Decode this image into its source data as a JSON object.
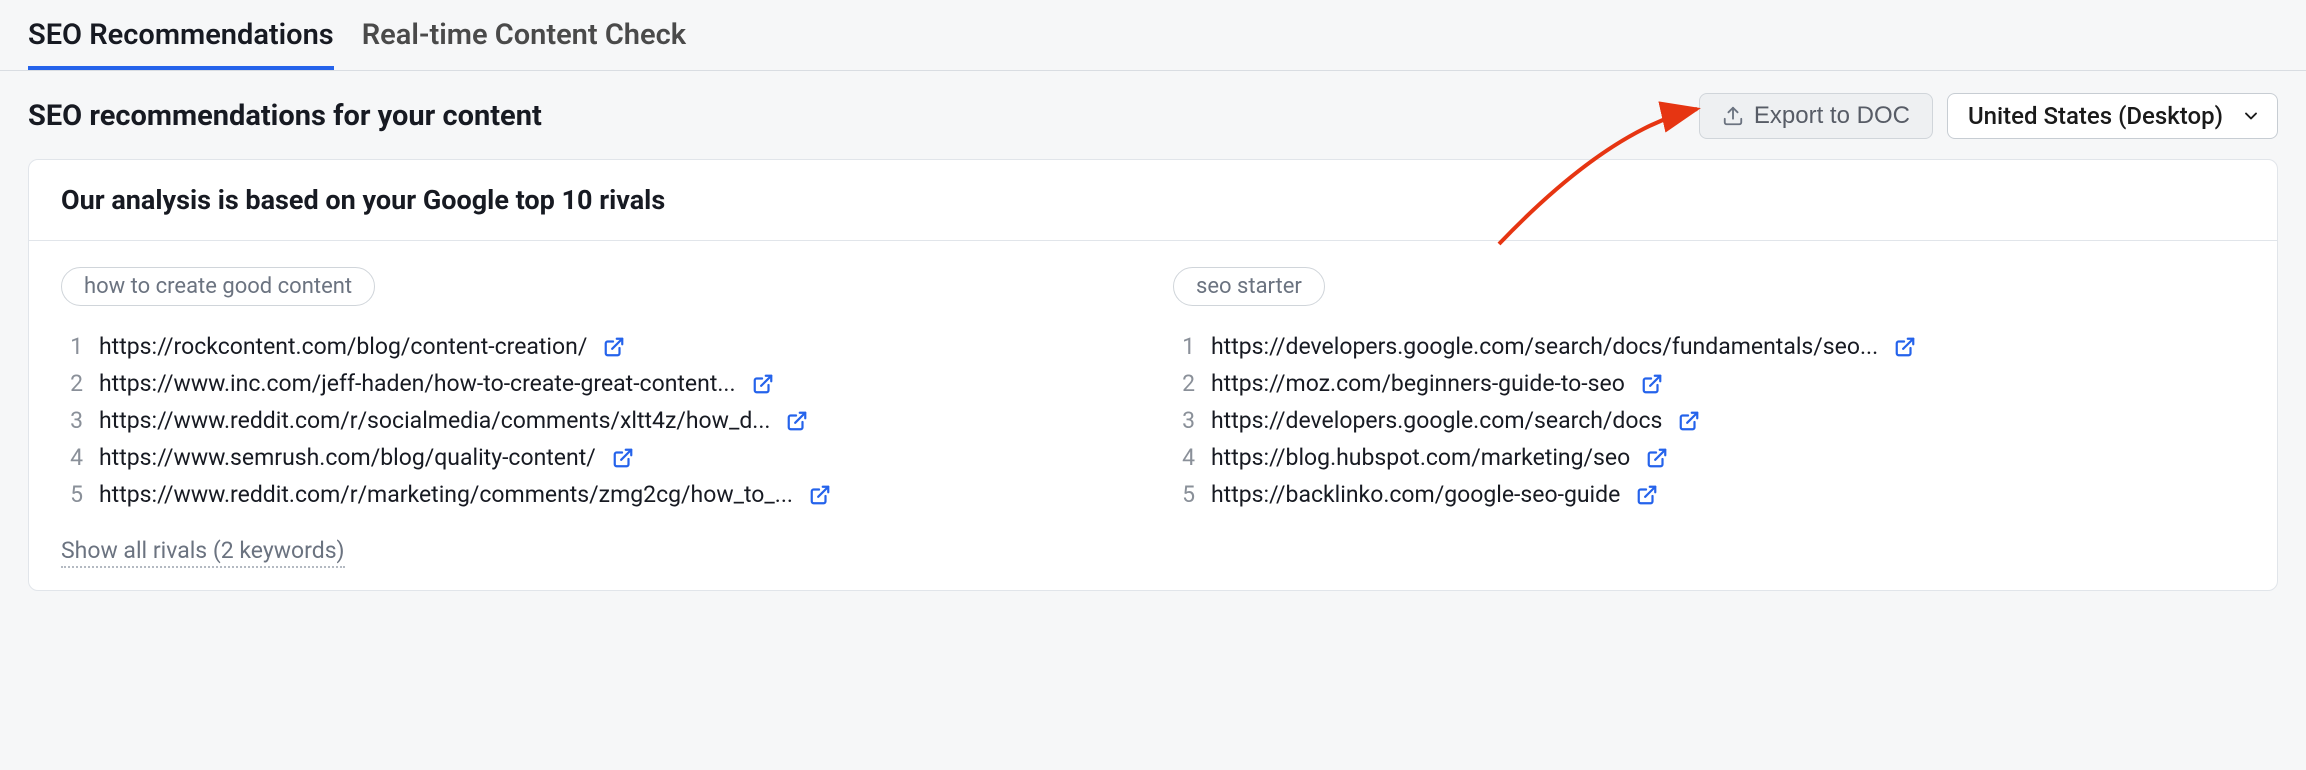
{
  "tabs": [
    {
      "label": "SEO Recommendations",
      "active": true
    },
    {
      "label": "Real-time Content Check",
      "active": false
    }
  ],
  "page_title": "SEO recommendations for your content",
  "export_label": "Export to DOC",
  "locale_selector": "United States (Desktop)",
  "card_title": "Our analysis is based on your Google top 10 rivals",
  "columns": [
    {
      "keyword": "how to create good content",
      "rivals": [
        "https://rockcontent.com/blog/content-creation/",
        "https://www.inc.com/jeff-haden/how-to-create-great-content...",
        "https://www.reddit.com/r/socialmedia/comments/xltt4z/how_d...",
        "https://www.semrush.com/blog/quality-content/",
        "https://www.reddit.com/r/marketing/comments/zmg2cg/how_to_..."
      ]
    },
    {
      "keyword": "seo starter",
      "rivals": [
        "https://developers.google.com/search/docs/fundamentals/seo...",
        "https://moz.com/beginners-guide-to-seo",
        "https://developers.google.com/search/docs",
        "https://blog.hubspot.com/marketing/seo",
        "https://backlinko.com/google-seo-guide"
      ]
    }
  ],
  "show_all_label": "Show all rivals (2 keywords)"
}
